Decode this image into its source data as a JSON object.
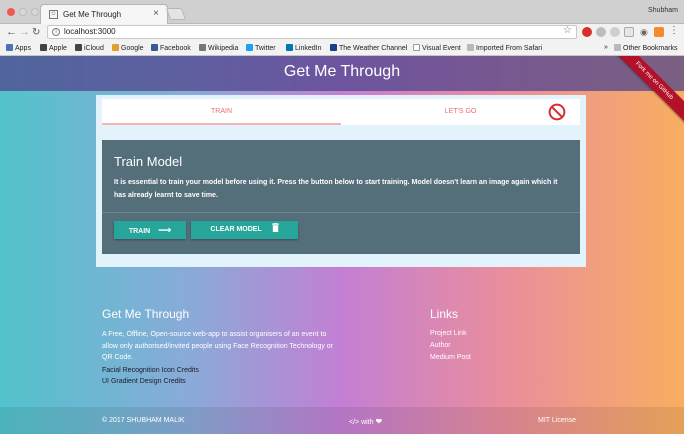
{
  "browser": {
    "tab_title": "Get Me Through",
    "profile": "Shubham",
    "url": "localhost:3000",
    "bookmarks": [
      {
        "label": "Apps",
        "icon": "apps-grid-icon",
        "color": "#4a75b5"
      },
      {
        "label": "Apple",
        "icon": "apple-icon",
        "color": "#444444"
      },
      {
        "label": "iCloud",
        "icon": "apple-icon",
        "color": "#444444"
      },
      {
        "label": "Google",
        "icon": "google-icon",
        "color": "#e0a030"
      },
      {
        "label": "Facebook",
        "icon": "facebook-icon",
        "color": "#3b5998"
      },
      {
        "label": "Wikipedia",
        "icon": "wikipedia-icon",
        "color": "#777777"
      },
      {
        "label": "Twitter",
        "icon": "twitter-icon",
        "color": "#1da1f2"
      },
      {
        "label": "LinkedIn",
        "icon": "linkedin-icon",
        "color": "#0077b5"
      },
      {
        "label": "The Weather Channel",
        "icon": "weather-icon",
        "color": "#1b3f8b"
      },
      {
        "label": "Visual Event",
        "icon": "page-icon",
        "color": "#999999"
      },
      {
        "label": "Imported From Safari",
        "icon": "folder-icon",
        "color": "#9a9a9a"
      }
    ],
    "other_bookmarks": "Other Bookmarks",
    "overflow": "»"
  },
  "page": {
    "brand": "Get Me Through",
    "ribbon": "Fork me on GitHub",
    "tabs": {
      "train": "TRAIN",
      "go": "LET'S GO"
    },
    "panel": {
      "title": "Train Model",
      "text": "It is essential to train your model before using it. Press the button below to start training. Model doesn't learn an image again which it has already learnt to save time.",
      "train_button": "TRAIN",
      "clear_button": "CLEAR MODEL"
    },
    "footer": {
      "title": "Get Me Through",
      "description": "A Free, Offline, Open-source web-app to assist organisers of an event to allow only authorised/invited people using Face Recognition Technology or QR Code.",
      "credit_links": [
        "Facial Recognition Icon Credits",
        "UI Gradient Design Credits"
      ],
      "links_title": "Links",
      "links": [
        "Project Link",
        "Author",
        "Medium Post"
      ],
      "copyright": "© 2017 SHUBHAM MALIK",
      "made_with": "</> with",
      "license": "MIT License"
    }
  },
  "colors": {
    "accent": "#ee6e73",
    "panel": "#546e7a",
    "button": "#26a69a",
    "ribbon": "#b3102a"
  }
}
